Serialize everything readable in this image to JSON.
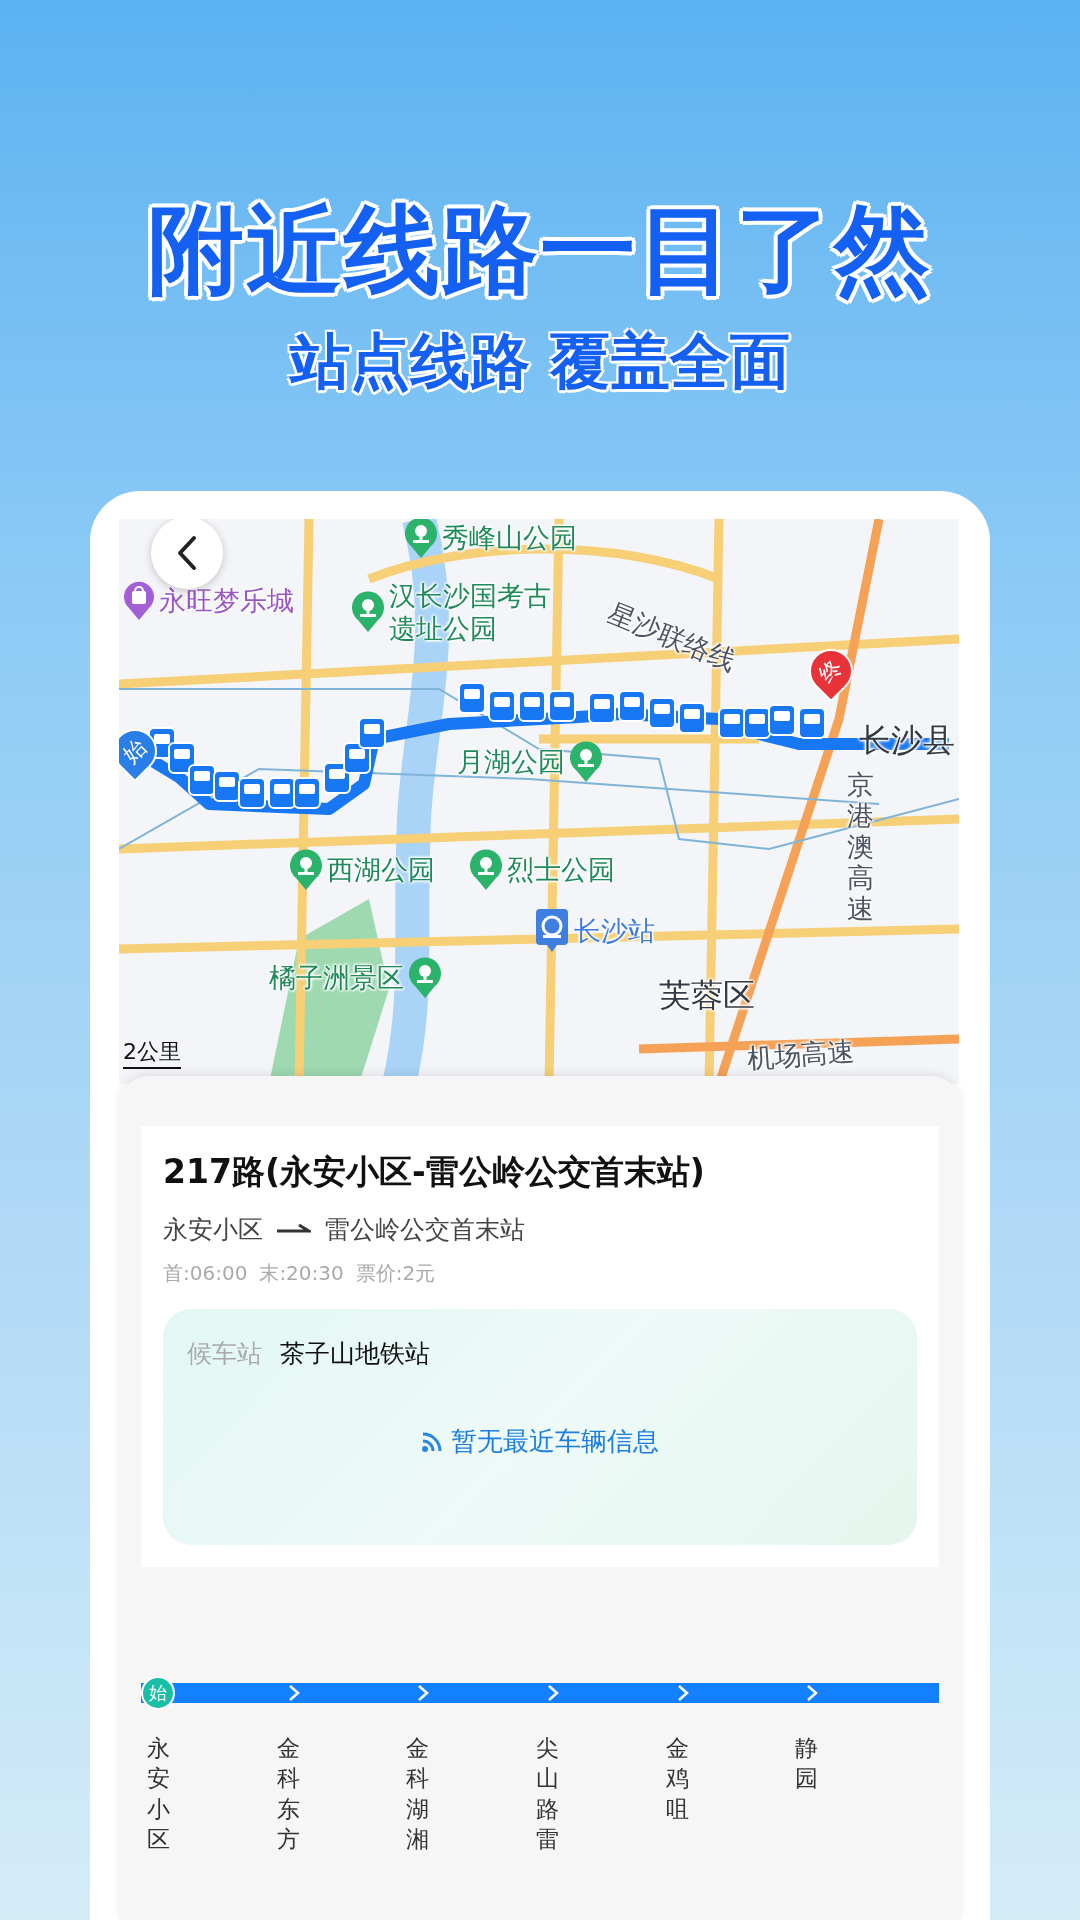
{
  "headline": "附近线路一目了然",
  "subheadline": "站点线路 覆盖全面",
  "map": {
    "labels": [
      {
        "text": "秀峰山公园",
        "kind": "park"
      },
      {
        "text": "永旺梦乐城",
        "kind": "mall"
      },
      {
        "text": "汉长沙国考古遗址公园",
        "kind": "park"
      },
      {
        "text": "星沙联络线",
        "kind": "road"
      },
      {
        "text": "长沙县",
        "kind": "district"
      },
      {
        "text": "月湖公园",
        "kind": "park"
      },
      {
        "text": "京港澳高速",
        "kind": "highway"
      },
      {
        "text": "西湖公园",
        "kind": "park"
      },
      {
        "text": "烈士公园",
        "kind": "park"
      },
      {
        "text": "长沙站",
        "kind": "station"
      },
      {
        "text": "橘子洲景区",
        "kind": "scenic"
      },
      {
        "text": "芙蓉区",
        "kind": "district"
      },
      {
        "text": "机场高速",
        "kind": "road"
      }
    ],
    "scale": "2公里",
    "start_marker": "始",
    "end_marker": "终"
  },
  "route": {
    "title": "217路(永安小区-雷公岭公交首末站)",
    "from": "永安小区",
    "to": "雷公岭公交首末站",
    "first_bus": "首:06:00",
    "last_bus": "末:20:30",
    "fare": "票价:2元",
    "waiting_label": "候车站",
    "waiting_stop": "茶子山地铁站",
    "realtime_status": "暂无最近车辆信息"
  },
  "stops": [
    {
      "name": "永安小区",
      "badge": "始"
    },
    {
      "name": "金科东方"
    },
    {
      "name": "金科湖湘"
    },
    {
      "name": "尖山路雷"
    },
    {
      "name": "金鸡咀"
    },
    {
      "name": "静园"
    }
  ]
}
